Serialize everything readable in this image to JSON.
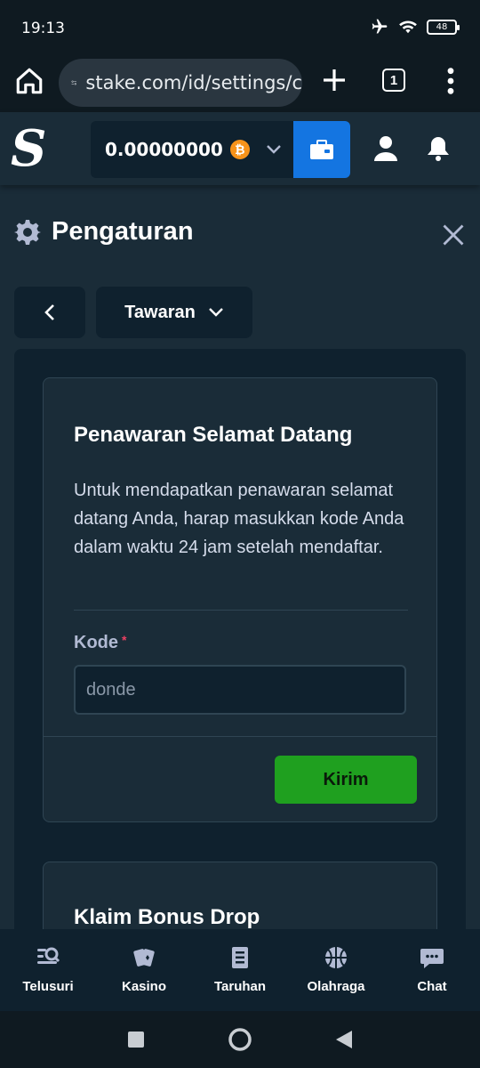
{
  "status": {
    "time": "19:13",
    "battery": "48"
  },
  "browser": {
    "url": "stake.com/id/settings/c",
    "tab_count": "1"
  },
  "header": {
    "logo": "S",
    "balance": "0.00000000",
    "currency_symbol": "₿"
  },
  "settings": {
    "title": "Pengaturan",
    "dropdown_label": "Tawaran"
  },
  "welcome_card": {
    "title": "Penawaran Selamat Datang",
    "description": "Untuk mendapatkan penawaran selamat datang Anda, harap masukkan kode Anda dalam waktu 24 jam setelah mendaftar.",
    "field_label": "Kode",
    "required_mark": "*",
    "input_placeholder": "donde",
    "submit_label": "Kirim"
  },
  "bonus_card": {
    "title": "Klaim Bonus Drop"
  },
  "bottom_nav": [
    {
      "label": "Telusuri",
      "icon": "search-browse-icon"
    },
    {
      "label": "Kasino",
      "icon": "cards-icon"
    },
    {
      "label": "Taruhan",
      "icon": "betslip-icon"
    },
    {
      "label": "Olahraga",
      "icon": "basketball-icon"
    },
    {
      "label": "Chat",
      "icon": "chat-icon"
    }
  ],
  "colors": {
    "accent": "#1475e1",
    "success": "#1fa01f",
    "bg": "#1a2c38",
    "panel": "#0f212e"
  }
}
